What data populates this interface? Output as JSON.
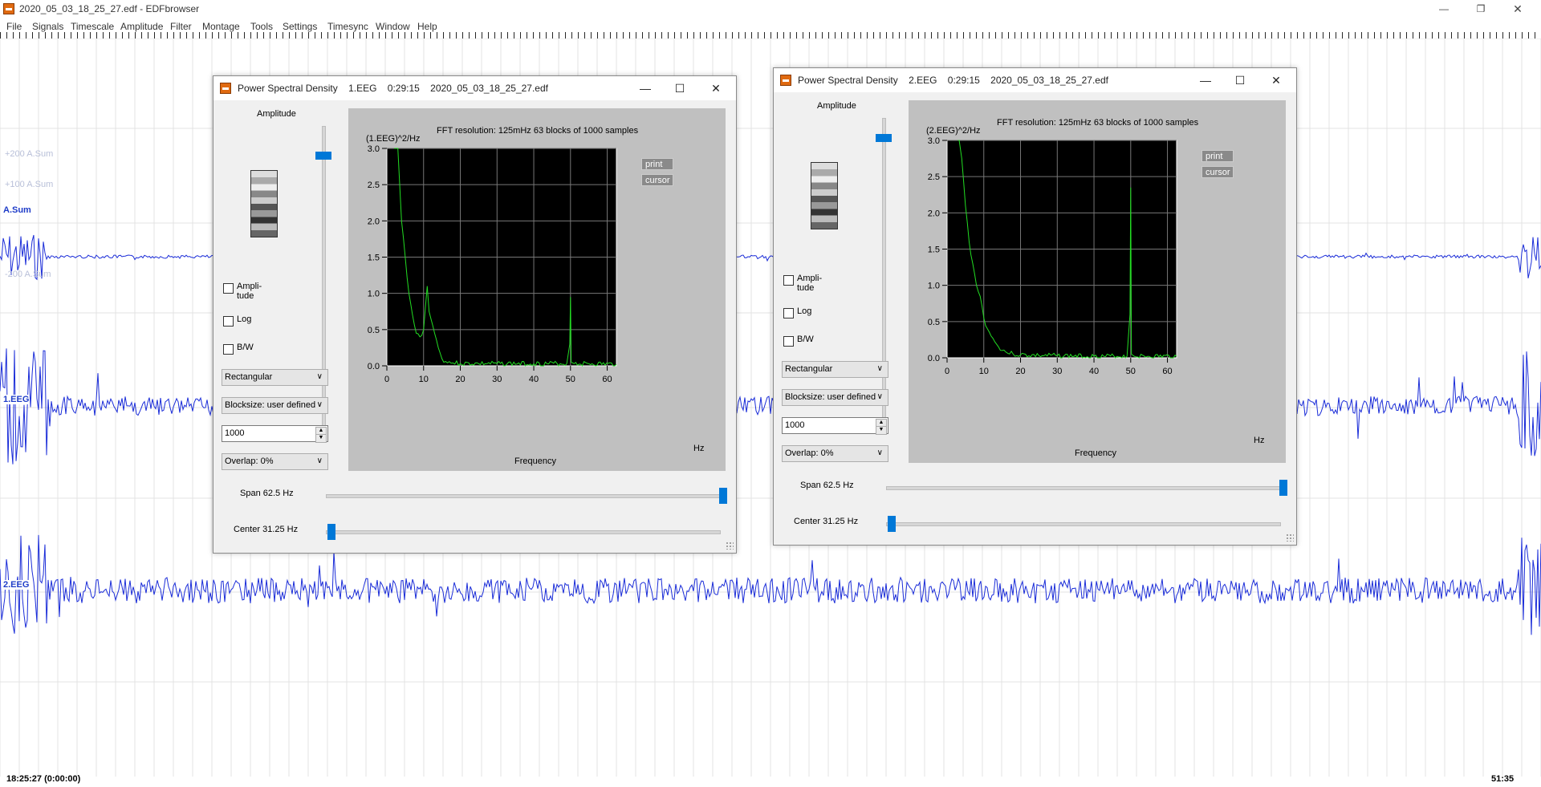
{
  "window": {
    "title": "2020_05_03_18_25_27.edf - EDFbrowser",
    "menu": [
      "File",
      "Signals",
      "Timescale",
      "Amplitude",
      "Filter",
      "Montage",
      "Tools",
      "Settings",
      "Timesync",
      "Window",
      "Help"
    ]
  },
  "signals": {
    "channels": [
      {
        "label": "A.Sum",
        "amp_top": "+200 A.Sum",
        "amp_mid": "+100 A.Sum",
        "amp_bottom": "-200 A.Sum"
      },
      {
        "label": "1.EEG"
      },
      {
        "label": "2.EEG"
      }
    ],
    "time_start": "18:25:27 (0:00:00)",
    "time_end": "51:35",
    "trace_color": "#1a2cd8"
  },
  "dialogs": [
    {
      "title_type": "Power Spectral Density",
      "title_signal": "1.EEG",
      "title_time": "0:29:15",
      "title_file": "2020_05_03_18_25_27.edf",
      "amplitude_label": "Amplitude",
      "checkboxes": [
        {
          "line1": "Ampli-",
          "line2": "tude",
          "checked": false
        },
        {
          "line1": "Log",
          "line2": "",
          "checked": false
        },
        {
          "line1": "B/W",
          "line2": "",
          "checked": false
        }
      ],
      "window_fn": "Rectangular",
      "blocksize": "Blocksize: user defined",
      "blocksize_value": "1000",
      "overlap": "Overlap: 0%",
      "plot": {
        "ylabel": "(1.EEG)^2/Hz",
        "info": "FFT resolution: 125mHz   63 blocks of 1000 samples",
        "print_btn": "print",
        "cursor_btn": "cursor",
        "xlabel": "Frequency",
        "xunit": "Hz"
      },
      "span_label": "Span 62.5 Hz",
      "center_label": "Center 31.25 Hz",
      "span_value": 1.0,
      "center_value": 0.0
    },
    {
      "title_type": "Power Spectral Density",
      "title_signal": "2.EEG",
      "title_time": "0:29:15",
      "title_file": "2020_05_03_18_25_27.edf",
      "amplitude_label": "Amplitude",
      "checkboxes": [
        {
          "line1": "Ampli-",
          "line2": "tude",
          "checked": false
        },
        {
          "line1": "Log",
          "line2": "",
          "checked": false
        },
        {
          "line1": "B/W",
          "line2": "",
          "checked": false
        }
      ],
      "window_fn": "Rectangular",
      "blocksize": "Blocksize: user defined",
      "blocksize_value": "1000",
      "overlap": "Overlap: 0%",
      "plot": {
        "ylabel": "(2.EEG)^2/Hz",
        "info": "FFT resolution: 125mHz   63 blocks of 1000 samples",
        "print_btn": "print",
        "cursor_btn": "cursor",
        "xlabel": "Frequency",
        "xunit": "Hz"
      },
      "span_label": "Span 62.5 Hz",
      "center_label": "Center 31.25 Hz",
      "span_value": 1.0,
      "center_value": 0.0
    }
  ],
  "chart_data": [
    {
      "type": "line",
      "title": "",
      "xlabel": "Frequency",
      "ylabel": "(1.EEG)^2/Hz",
      "xlim": [
        0,
        62.5
      ],
      "ylim": [
        0,
        3.0
      ],
      "xticks": [
        0,
        10,
        20,
        30,
        40,
        50,
        60
      ],
      "yticks": [
        "0.0",
        "0.5",
        "1.0",
        "1.5",
        "2.0",
        "2.5",
        "3.0"
      ],
      "grid": true,
      "line_color": "#22dd22",
      "series": [
        {
          "x": [
            2,
            3,
            3.5,
            4,
            5,
            6,
            7,
            8,
            9,
            10,
            10.5,
            11,
            11.5,
            12,
            13,
            14,
            15,
            16,
            18,
            20,
            25,
            30,
            40,
            49,
            49.8,
            50,
            50.2,
            51,
            55,
            62.5
          ],
          "y": [
            3.0,
            3.0,
            2.5,
            2.0,
            1.5,
            1.0,
            0.7,
            0.45,
            0.4,
            0.5,
            0.8,
            1.1,
            0.75,
            0.65,
            0.45,
            0.25,
            0.1,
            0.06,
            0.04,
            0.03,
            0.03,
            0.03,
            0.03,
            0.03,
            0.3,
            0.95,
            0.05,
            0.03,
            0.03,
            0.02
          ]
        }
      ]
    },
    {
      "type": "line",
      "title": "",
      "xlabel": "Frequency",
      "ylabel": "(2.EEG)^2/Hz",
      "xlim": [
        0,
        62.5
      ],
      "ylim": [
        0,
        3.0
      ],
      "xticks": [
        0,
        10,
        20,
        30,
        40,
        50,
        60
      ],
      "yticks": [
        "0.0",
        "0.5",
        "1.0",
        "1.5",
        "2.0",
        "2.5",
        "3.0"
      ],
      "grid": true,
      "line_color": "#22dd22",
      "series": [
        {
          "x": [
            3,
            3.3,
            4,
            5,
            6,
            7,
            8,
            9,
            10,
            11,
            12,
            13,
            14,
            16,
            18,
            20,
            25,
            30,
            40,
            49,
            49.8,
            50,
            50.2,
            51,
            55,
            62.5
          ],
          "y": [
            3.0,
            3.0,
            2.75,
            2.1,
            1.6,
            1.3,
            1.0,
            0.85,
            0.55,
            0.4,
            0.3,
            0.22,
            0.15,
            0.08,
            0.05,
            0.04,
            0.03,
            0.03,
            0.02,
            0.02,
            0.6,
            2.35,
            0.05,
            0.02,
            0.02,
            0.02
          ]
        }
      ]
    }
  ]
}
